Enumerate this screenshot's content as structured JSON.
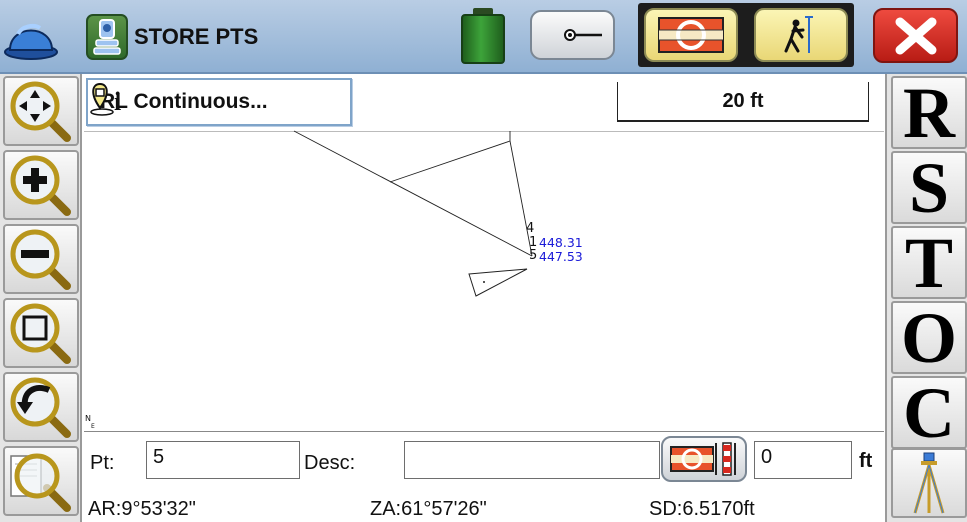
{
  "topbar": {
    "app_icon": "hardhat-icon",
    "store_label": "STORE PTS",
    "store_icon": "robot-instrument-icon",
    "battery_icon": "battery-icon",
    "prism_icon": "prism-pole-icon",
    "mode_buttons": [
      "instrument-mode-icon",
      "walking-rodman-icon"
    ],
    "close_icon": "close-x-icon"
  },
  "left_toolbar": {
    "buttons": [
      "zoom-pan-icon",
      "zoom-in-icon",
      "zoom-out-icon",
      "zoom-window-icon",
      "zoom-previous-icon",
      "zoom-extents-icon"
    ]
  },
  "right_toolbar": {
    "letters": [
      "R",
      "S",
      "T",
      "O",
      "C"
    ],
    "tripod_icon": "tripod-icon"
  },
  "map": {
    "routine_label": "RL Continuous...",
    "routine_icon": "info-point-icon",
    "scale_label": "20 ft",
    "point_labels": [
      "4",
      "1",
      "5"
    ],
    "elevations": [
      "448.31",
      "447.53"
    ],
    "north_arrow": "N",
    "north_sub": "E"
  },
  "bottom": {
    "pt_label": "Pt:",
    "pt_value": "5",
    "desc_label": "Desc:",
    "desc_value": "",
    "rod_height_value": "0",
    "rod_unit": "ft",
    "ar_text": "AR:9°53'32\"",
    "za_text": "ZA:61°57'26\"",
    "sd_text": "SD:6.5170ft"
  },
  "colors": {
    "topbar": "#a7c0dc",
    "elevation_text": "#1a1ad8",
    "close_red": "#d7281e",
    "mode_yellow": "#f3e69a"
  }
}
